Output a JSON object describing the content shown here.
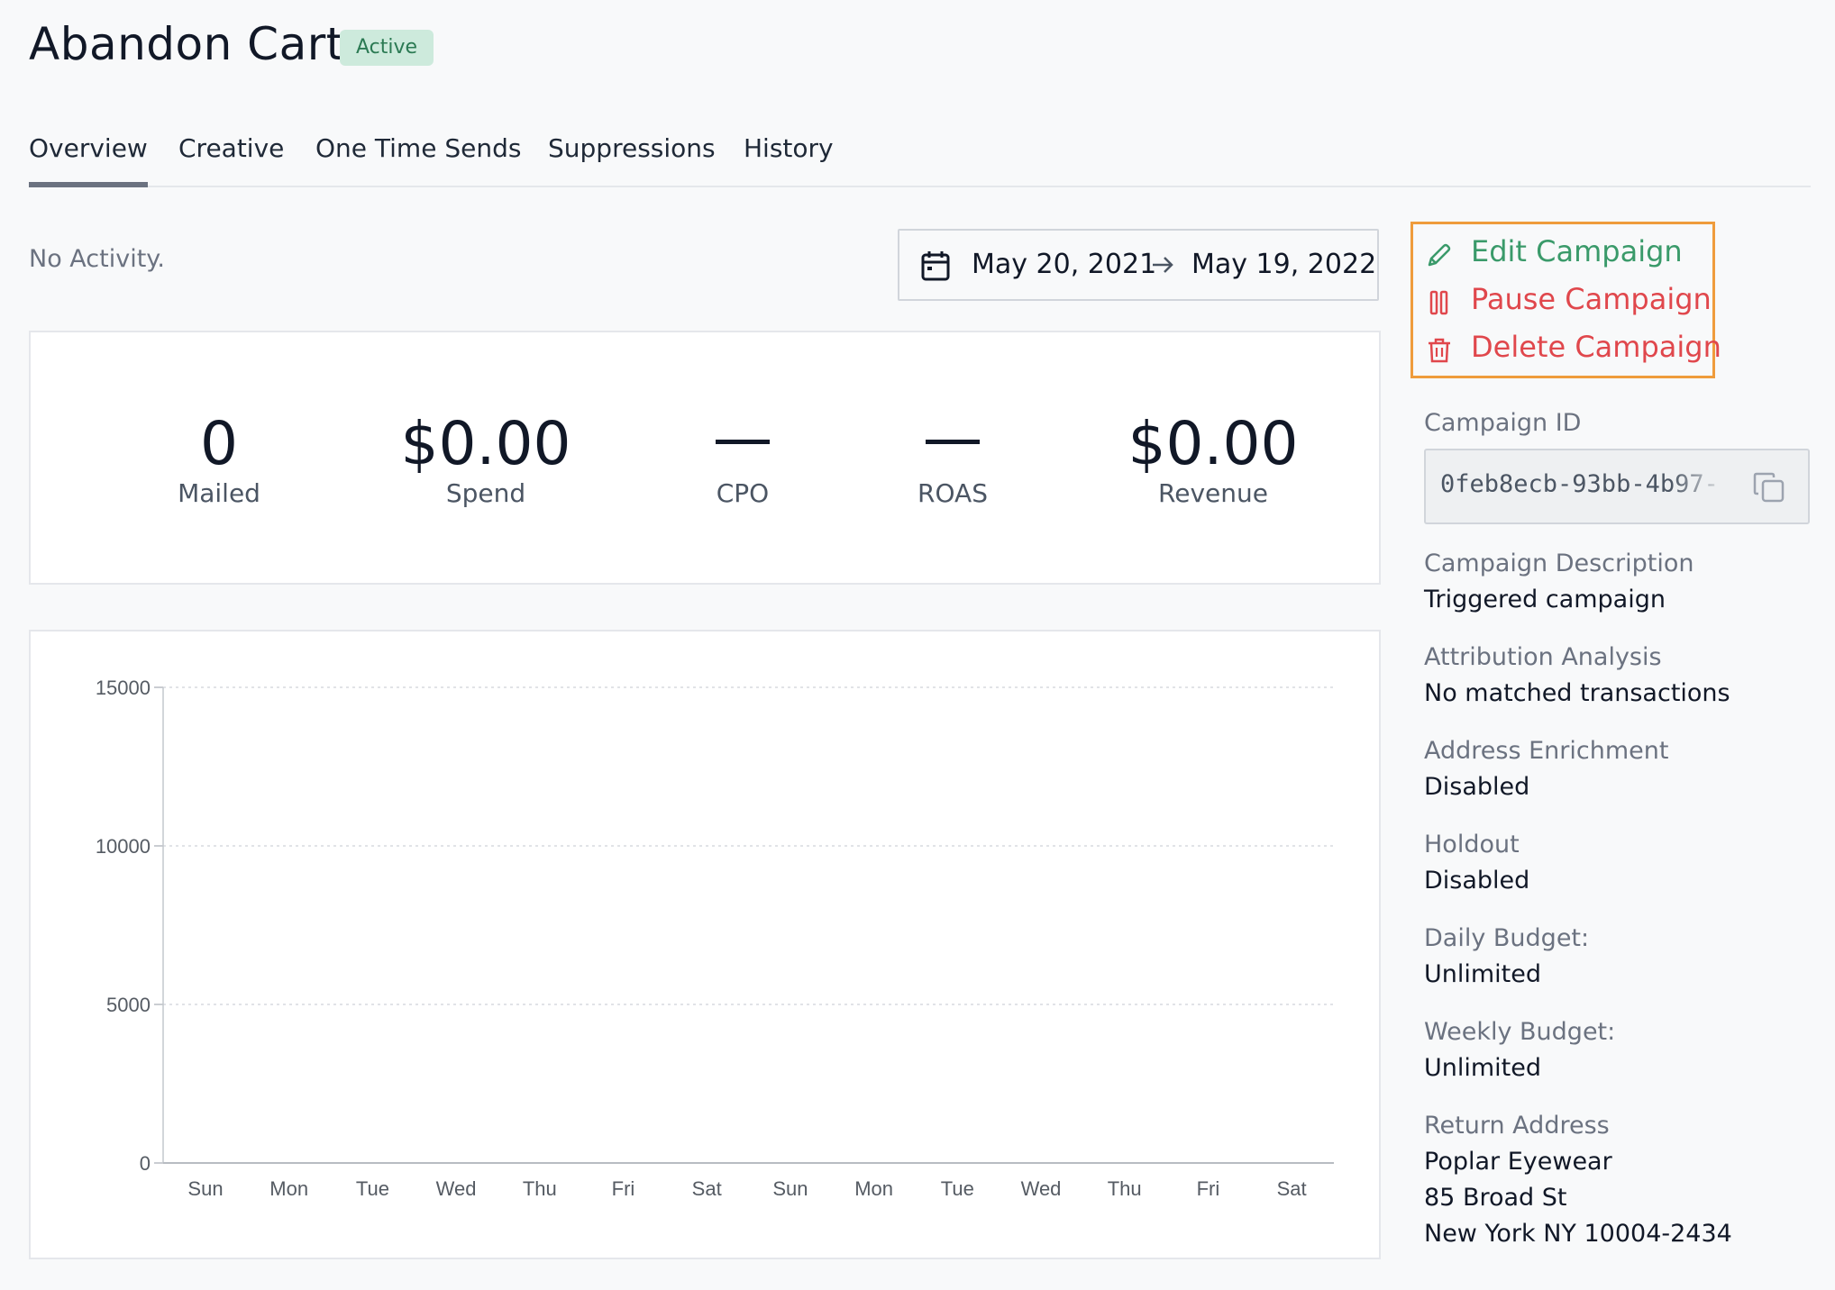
{
  "header": {
    "title": "Abandon Cart",
    "status": "Active"
  },
  "tabs": [
    {
      "label": "Overview",
      "active": true
    },
    {
      "label": "Creative",
      "active": false
    },
    {
      "label": "One Time Sends",
      "active": false
    },
    {
      "label": "Suppressions",
      "active": false
    },
    {
      "label": "History",
      "active": false
    }
  ],
  "overview": {
    "activity_text": "No Activity.",
    "date_range": {
      "start": "May 20, 2021",
      "end": "May 19, 2022",
      "icon": "calendar-icon",
      "separator_icon": "arrow-right-icon"
    }
  },
  "stats": [
    {
      "value": "0",
      "label": "Mailed"
    },
    {
      "value": "$0.00",
      "label": "Spend"
    },
    {
      "value": "—",
      "label": "CPO"
    },
    {
      "value": "—",
      "label": "ROAS"
    },
    {
      "value": "$0.00",
      "label": "Revenue"
    }
  ],
  "chart_data": {
    "type": "bar",
    "categories": [
      "Sun",
      "Mon",
      "Tue",
      "Wed",
      "Thu",
      "Fri",
      "Sat",
      "Sun",
      "Mon",
      "Tue",
      "Wed",
      "Thu",
      "Fri",
      "Sat"
    ],
    "values": [
      0,
      0,
      0,
      0,
      0,
      0,
      0,
      0,
      0,
      0,
      0,
      0,
      0,
      0
    ],
    "yticks": [
      0,
      5000,
      10000,
      15000
    ],
    "ylim": [
      0,
      15000
    ],
    "grid": true,
    "title": "",
    "xlabel": "",
    "ylabel": ""
  },
  "actions": {
    "edit": {
      "label": "Edit Campaign",
      "icon": "pencil-icon",
      "color": "#3a9a6a"
    },
    "pause": {
      "label": "Pause Campaign",
      "icon": "pause-icon",
      "color": "#e0474c"
    },
    "delete": {
      "label": "Delete Campaign",
      "icon": "trash-icon",
      "color": "#e0474c"
    }
  },
  "details": {
    "campaign_id_label": "Campaign ID",
    "campaign_id": "0feb8ecb-93bb-4b97-",
    "description_label": "Campaign Description",
    "description": "Triggered campaign",
    "attribution_label": "Attribution Analysis",
    "attribution": "No matched transactions",
    "enrichment_label": "Address Enrichment",
    "enrichment": "Disabled",
    "holdout_label": "Holdout",
    "holdout": "Disabled",
    "daily_budget_label": "Daily Budget:",
    "daily_budget": "Unlimited",
    "weekly_budget_label": "Weekly Budget:",
    "weekly_budget": "Unlimited",
    "return_address_label": "Return Address",
    "return_address_lines": [
      "Poplar Eyewear",
      "85 Broad St",
      "New York NY 10004-2434"
    ]
  }
}
